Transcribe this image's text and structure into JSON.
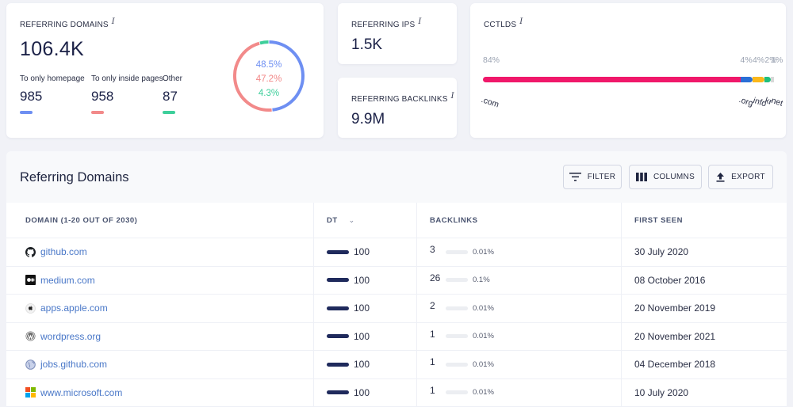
{
  "referring_domains": {
    "label": "Referring Domains",
    "info": "i",
    "total": "106.4K",
    "breakdown": [
      {
        "label": "To only homepage",
        "value": "985",
        "color": "#6e8ff2"
      },
      {
        "label": "To only inside pages",
        "value": "958",
        "color": "#f28a8a"
      },
      {
        "label": "Other",
        "value": "87",
        "color": "#3ecf9b"
      }
    ],
    "donut": [
      {
        "pct_label": "48.5%",
        "percent": 48.5,
        "color": "#6e8ff2"
      },
      {
        "pct_label": "47.2%",
        "percent": 47.2,
        "color": "#f28a8a"
      },
      {
        "pct_label": "4.3%",
        "percent": 4.3,
        "color": "#3ecf9b"
      }
    ]
  },
  "referring_ips": {
    "label": "Referring IPs",
    "info": "i",
    "value": "1.5K"
  },
  "referring_backlinks": {
    "label": "Referring Backlinks",
    "info": "i",
    "value": "9.9M"
  },
  "cctlds": {
    "label": "ccTLDs",
    "info": "i",
    "items": [
      {
        "tld": ".com",
        "pct_label": "84%",
        "percent": 84,
        "color": "#f0186a"
      },
      {
        "tld": ".org",
        "pct_label": "4%",
        "percent": 4,
        "color": "#2a6fd6"
      },
      {
        "tld": ".info",
        "pct_label": "4%",
        "percent": 4,
        "color": "#fbb81b"
      },
      {
        "tld": ".kr",
        "pct_label": "2%",
        "percent": 2,
        "color": "#1fbf7e"
      },
      {
        "tld": ".net",
        "pct_label": "1%",
        "percent": 1,
        "color": "#d8d8d8"
      }
    ]
  },
  "table_panel": {
    "title": "Referring Domains",
    "buttons": {
      "filter": "FILTER",
      "columns": "COLUMNS",
      "export": "EXPORT"
    },
    "headers": {
      "domain": "DOMAIN (1-20 OUT OF 2030)",
      "dt": "DT",
      "backlinks": "BACKLINKS",
      "first_seen": "FIRST SEEN"
    },
    "rows": [
      {
        "icon": "github-icon",
        "domain": "github.com",
        "dt": "100",
        "dt_percent": 100,
        "backlinks": "3",
        "bl_pct_label": "0.01%",
        "bl_percent": 0.01,
        "first_seen": "30 July 2020"
      },
      {
        "icon": "medium-icon",
        "domain": "medium.com",
        "dt": "100",
        "dt_percent": 100,
        "backlinks": "26",
        "bl_pct_label": "0.1%",
        "bl_percent": 0.1,
        "first_seen": "08 October 2016"
      },
      {
        "icon": "apple-icon",
        "domain": "apps.apple.com",
        "dt": "100",
        "dt_percent": 100,
        "backlinks": "2",
        "bl_pct_label": "0.01%",
        "bl_percent": 0.01,
        "first_seen": "20 November 2019"
      },
      {
        "icon": "wordpress-icon",
        "domain": "wordpress.org",
        "dt": "100",
        "dt_percent": 100,
        "backlinks": "1",
        "bl_pct_label": "0.01%",
        "bl_percent": 0.01,
        "first_seen": "20 November 2021"
      },
      {
        "icon": "globe-icon",
        "domain": "jobs.github.com",
        "dt": "100",
        "dt_percent": 100,
        "backlinks": "1",
        "bl_pct_label": "0.01%",
        "bl_percent": 0.01,
        "first_seen": "04 December 2018"
      },
      {
        "icon": "microsoft-icon",
        "domain": "www.microsoft.com",
        "dt": "100",
        "dt_percent": 100,
        "backlinks": "1",
        "bl_pct_label": "0.01%",
        "bl_percent": 0.01,
        "first_seen": "10 July 2020"
      }
    ]
  }
}
